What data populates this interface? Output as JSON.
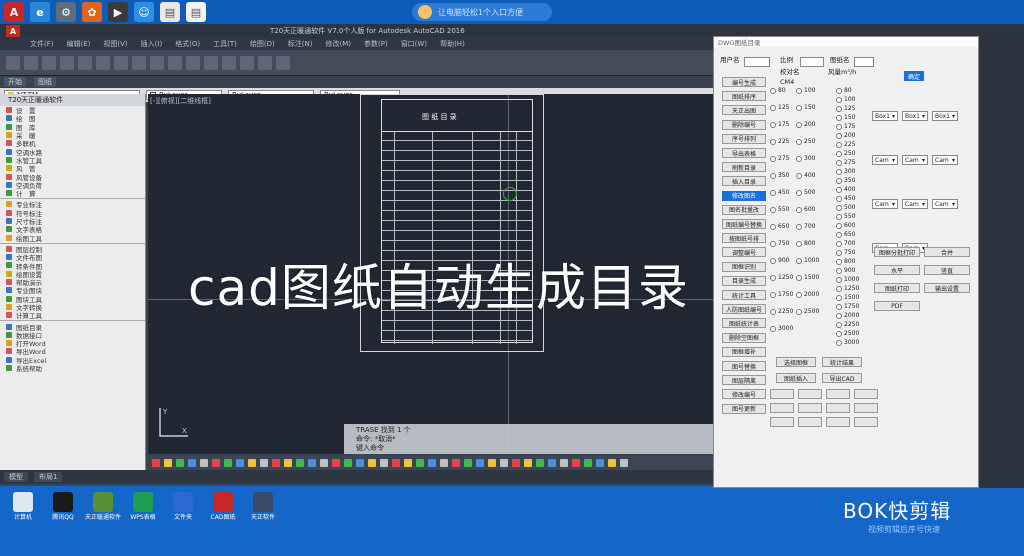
{
  "taskbar": {
    "search_text": "让电脑轻松1个入口方便"
  },
  "cad": {
    "title": "T20天正暖通软件 V7.0个人版 for Autodesk AutoCAD 2016",
    "menus": [
      "文件(F)",
      "编辑(E)",
      "视图(V)",
      "插入(I)",
      "格式(O)",
      "工具(T)",
      "绘图(D)",
      "标注(N)",
      "修改(M)",
      "参数(P)",
      "窗口(W)",
      "帮助(H)"
    ],
    "tabs": [
      "开始",
      "图纸"
    ],
    "layer_name": "NT-TM",
    "color_combo": "ByLayer",
    "linetype_combo": "ByLayer",
    "lineweight_combo": "ByLayer",
    "view_label": "[-][俯视][二维线框]",
    "sheet_title": "图 纸 目 录",
    "command_lines": [
      "TRASE 找到 1 个",
      "命令: *取消*",
      "键入命令"
    ],
    "layout_tabs": [
      "模型",
      "布局1"
    ],
    "palette_header": "T20天正暖通软件"
  },
  "left_palette": {
    "items": [
      "设　置",
      "绘　图",
      "图　库",
      "采　暖",
      "多联机",
      "空调水路",
      "水管工具",
      "风　管",
      "风管设备",
      "空调负荷",
      "计　算",
      "专业标注",
      "符号标注",
      "尺寸标注",
      "文字表格",
      "绘图工具",
      "图层控制",
      "文件布图",
      "转条件图",
      "绘图设置",
      "帮助演示",
      "专业图块",
      "图块工具",
      "文字转换",
      "计算工具",
      "图纸目录",
      "数据接口",
      "打开Word",
      "导出Word",
      "导出Excel",
      "系统帮助"
    ]
  },
  "plugin": {
    "title": "DWG图纸目录",
    "header_labels": [
      "用户名",
      "比例",
      "图纸名",
      "校对名",
      "CM4",
      "风量m³/h"
    ],
    "radio_values": [
      "80",
      "100",
      "125",
      "150",
      "175",
      "200",
      "225",
      "250",
      "275",
      "300",
      "350",
      "400",
      "450",
      "500",
      "550",
      "600",
      "650",
      "700",
      "750",
      "800",
      "900",
      "1000",
      "1250",
      "1500",
      "1750",
      "2000",
      "2250",
      "2500",
      "3000"
    ],
    "left_buttons": [
      "编号生成",
      "图纸排序",
      "天正出图",
      "删除编号",
      "序号排列",
      "导出表格",
      "刷新目录",
      "插入目录",
      "修改图名",
      "图名批量改",
      "图纸编号替换",
      "按图纸号排",
      "调整编号",
      "图框识别",
      "目录生成",
      "统计工具",
      "人防图纸编号",
      "图纸统计表",
      "删除空图框",
      "图框增补",
      "图号替换",
      "图层隔离",
      "修改编号",
      "图号更新"
    ],
    "mid_buttons": [
      "选择图框",
      "统计结果",
      "图纸插入",
      "导出CAD"
    ],
    "right_labels": [
      "图框分批打印",
      "合并",
      "水平",
      "竖直",
      "图纸打印",
      "输出设置",
      "PDF"
    ],
    "select_values": [
      "Box1",
      "Box1",
      "Box1",
      "Cam",
      "Cam",
      "Cam",
      "Cam",
      "Cam",
      "Cam",
      "Cam",
      "Cam"
    ],
    "action_button": "确定"
  },
  "overlay": {
    "caption": "cad图纸自动生成目录"
  },
  "desktop": {
    "icons": [
      "计算机",
      "腾讯QQ",
      "天正暖通软件",
      "WPS表格",
      "文件夹",
      "CAD图纸",
      "天正软件"
    ]
  },
  "watermark": {
    "brand": "BOK快剪辑",
    "sub": "视频剪辑后序号快速"
  }
}
